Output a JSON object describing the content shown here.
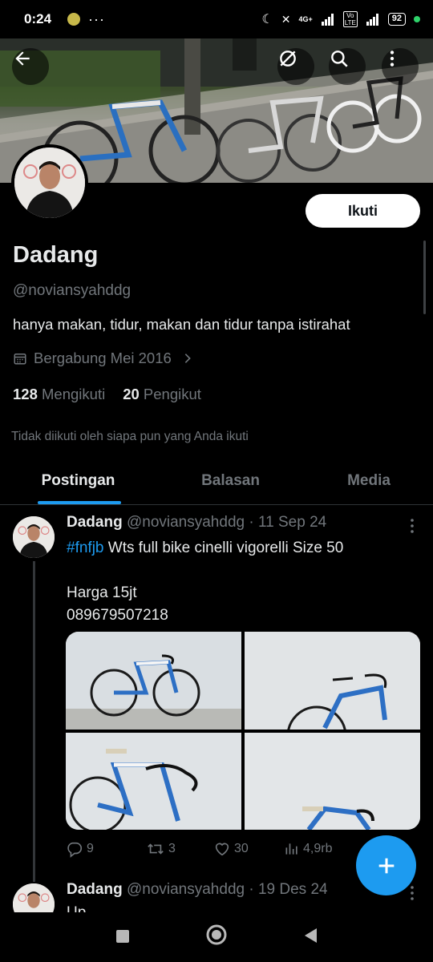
{
  "status_bar": {
    "time": "0:24",
    "network": "4G+",
    "volte": "Vo LTE",
    "battery": "92"
  },
  "profile": {
    "display_name": "Dadang",
    "handle": "@noviansyahddg",
    "bio": "hanya makan, tidur, makan dan tidur tanpa istirahat",
    "joined": "Bergabung Mei 2016",
    "following_count": "128",
    "following_label": "Mengikuti",
    "followers_count": "20",
    "followers_label": "Pengikut",
    "not_followed_note": "Tidak diikuti oleh siapa pun yang Anda ikuti",
    "follow_button": "Ikuti"
  },
  "tabs": [
    {
      "label": "Postingan",
      "active": true
    },
    {
      "label": "Balasan",
      "active": false
    },
    {
      "label": "Media",
      "active": false
    }
  ],
  "tweets": [
    {
      "name": "Dadang",
      "handle": "@noviansyahddg",
      "date": "11 Sep 24",
      "hashtag": "#fnfjb",
      "text_rest": " Wts full bike cinelli vigorelli Size 50",
      "line2": "Harga 15jt",
      "line3": "089679507218",
      "replies": "9",
      "retweets": "3",
      "likes": "30",
      "views": "4,9rb"
    },
    {
      "name": "Dadang",
      "handle": "@noviansyahddg",
      "date": "19 Des 24",
      "text": "Up"
    }
  ],
  "colors": {
    "accent": "#1d9bf0",
    "background": "#000000",
    "secondary_text": "#71767b",
    "primary_text": "#e7e9ea"
  }
}
